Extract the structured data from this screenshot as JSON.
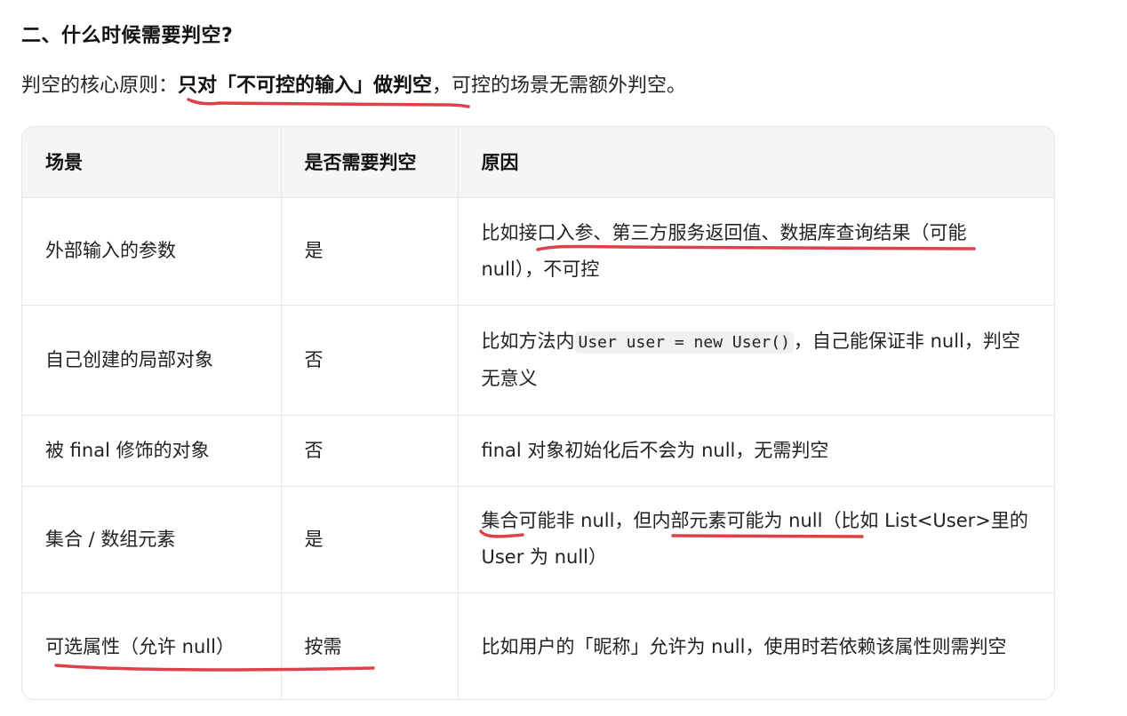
{
  "heading": "二、什么时候需要判空?",
  "intro": {
    "prefix": "判空的核心原则：",
    "emphasis": "只对「不可控的输入」做判空",
    "suffix": "，可控的场景无需额外判空。"
  },
  "table": {
    "headers": [
      "场景",
      "是否需要判空",
      "原因"
    ],
    "rows": [
      {
        "scene": "外部输入的参数",
        "need": "是",
        "reason": {
          "before": "比如",
          "mark": "接口入参、第三方服务返回值、数据库查询结果",
          "after": "（可能 null），不可控"
        }
      },
      {
        "scene": "自己创建的局部对象",
        "need": "否",
        "reason": {
          "before": "比如方法内",
          "code": "User user = new User()",
          "after": "，自己能保证非 null，判空无意义"
        }
      },
      {
        "scene": "被 final 修饰的对象",
        "need": "否",
        "reason": {
          "text": "final 对象初始化后不会为 null，无需判空"
        }
      },
      {
        "scene": "集合 / 数组元素",
        "need": "是",
        "reason": {
          "mark1": "集合",
          "middle": "可能非 null，但",
          "mark2": "内部元素可能为 null",
          "after": "（比如 List<User>里的 User 为 null）"
        }
      },
      {
        "scene": "可选属性（允许 null）",
        "need": "按需",
        "reason": {
          "text": "比如用户的「昵称」允许为 null，使用时若依赖该属性则需判空"
        }
      }
    ]
  },
  "colors": {
    "annotation_stroke": "#e0404a",
    "header_bg": "#f5f5f5",
    "border": "#e6e6e6"
  }
}
